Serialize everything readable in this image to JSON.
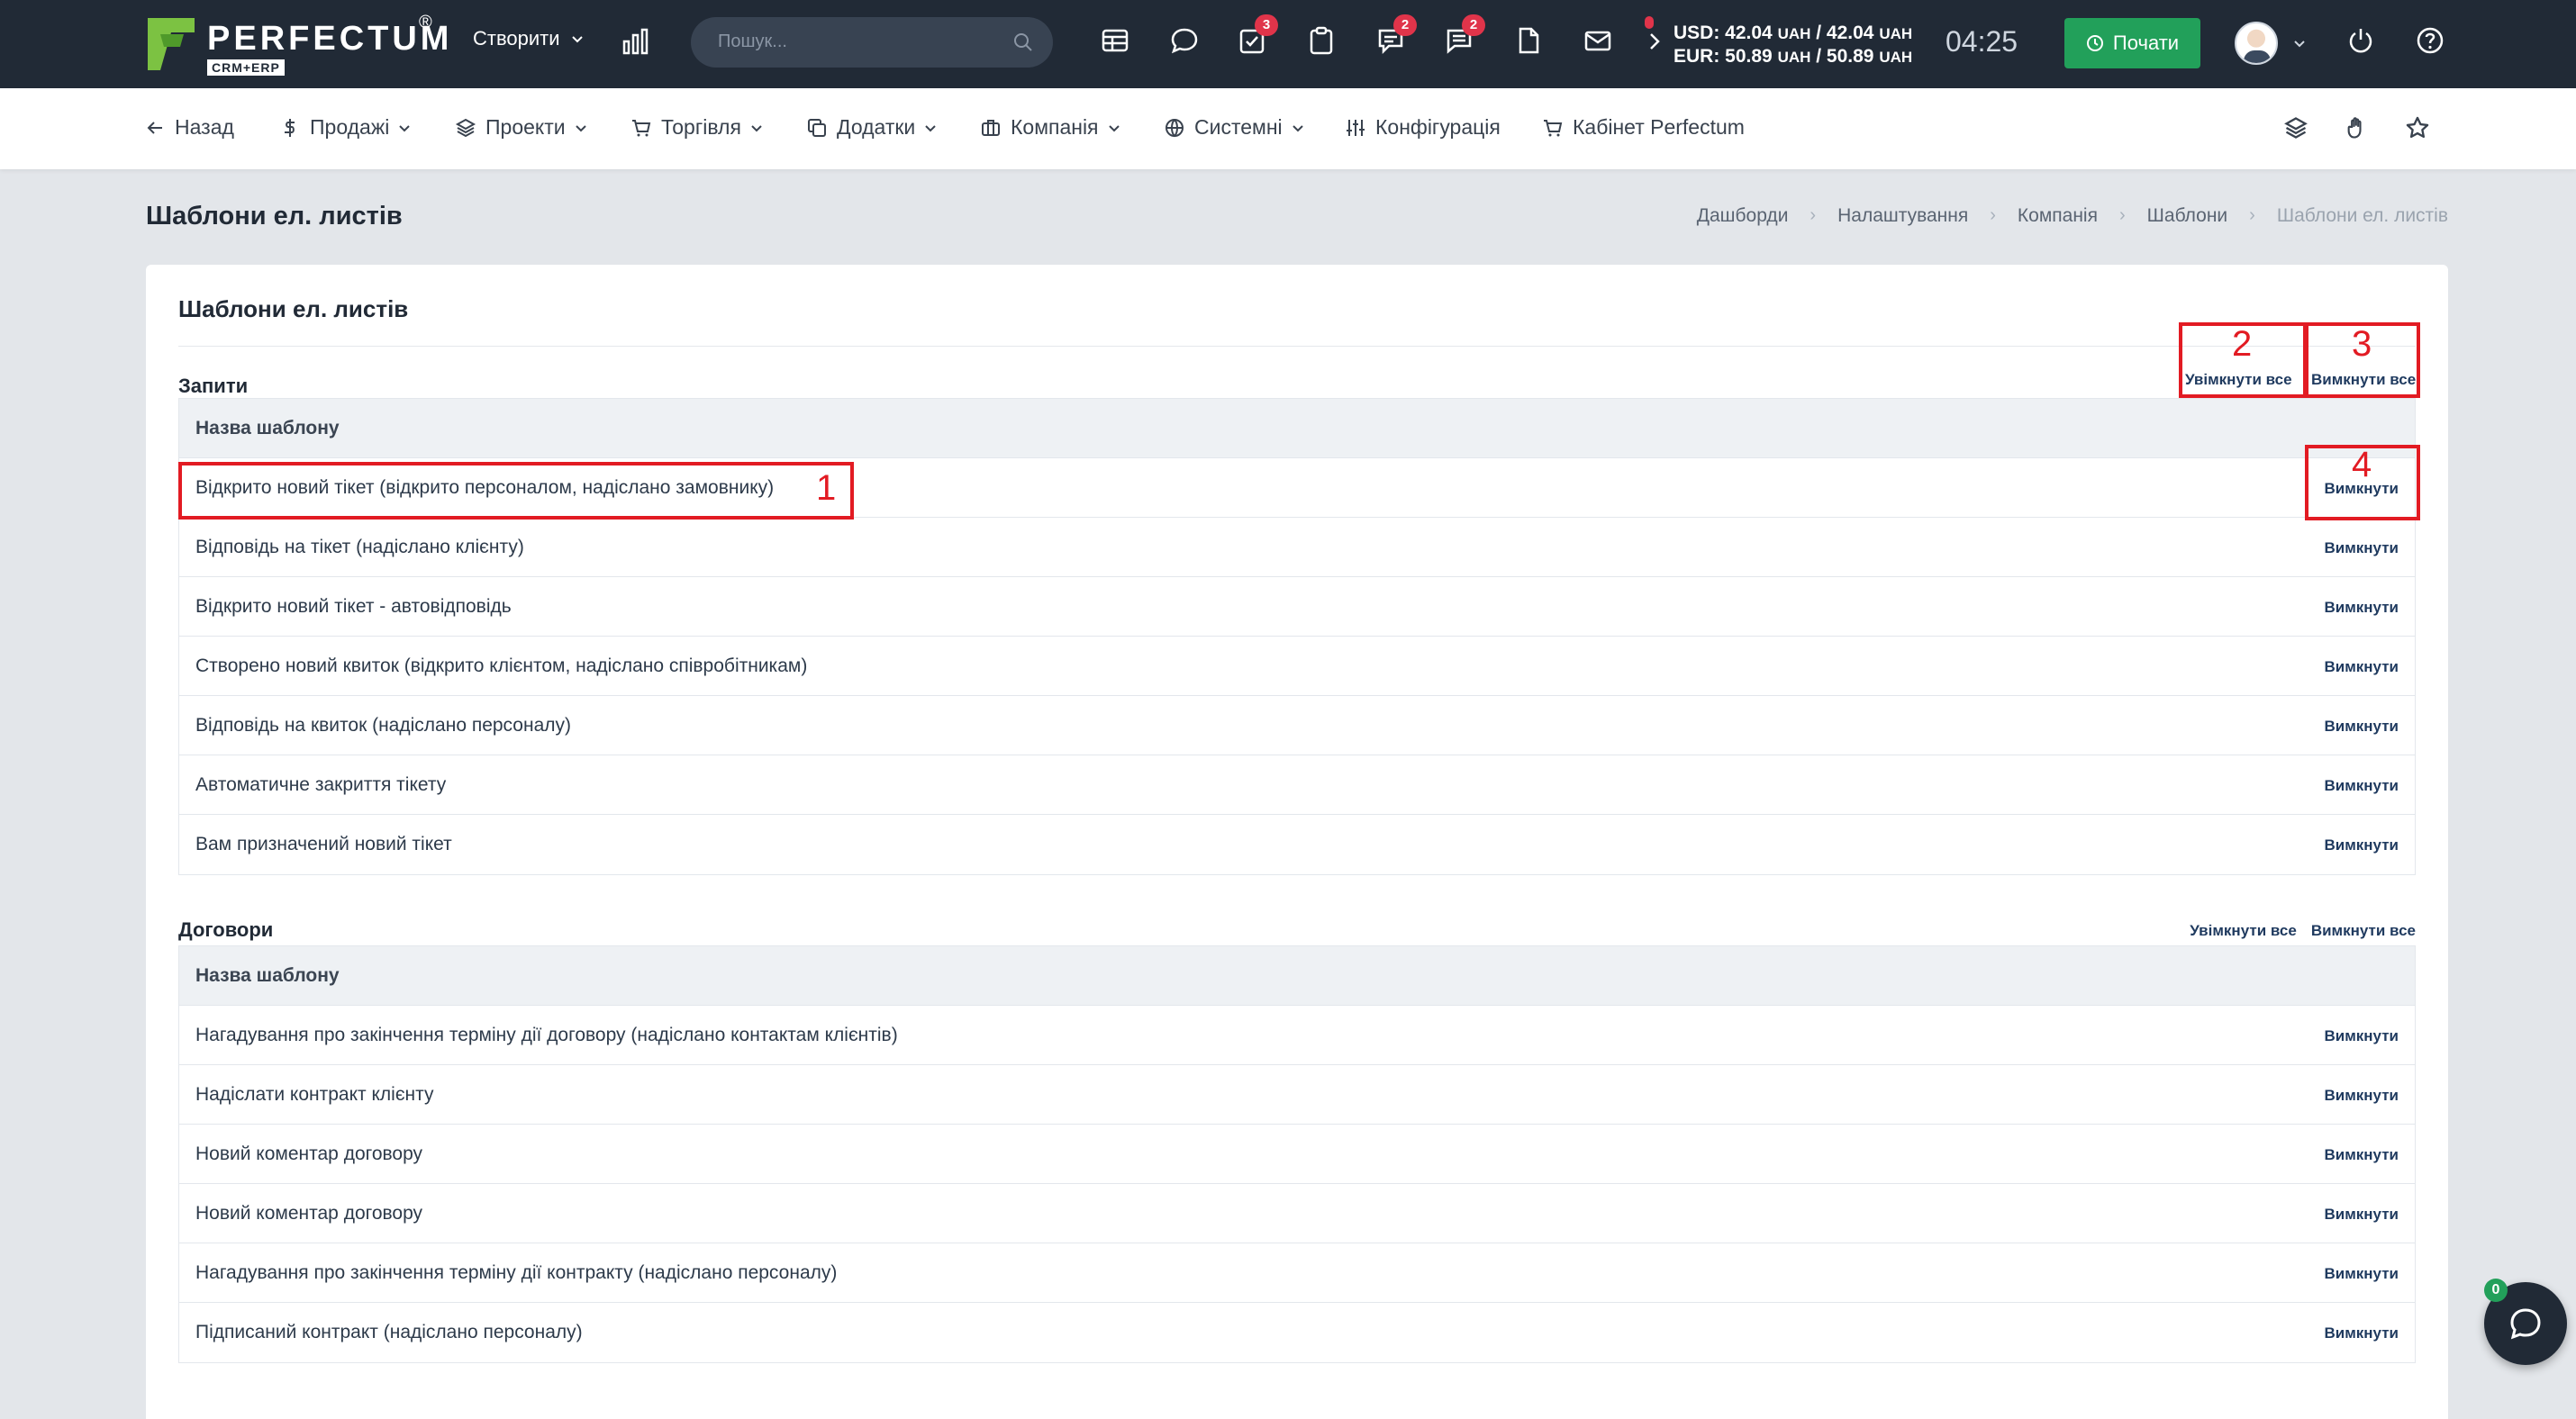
{
  "topbar": {
    "logo_text": "PERFECTUM",
    "logo_sub": "CRM+ERP",
    "logo_reg": "®",
    "create_label": "Створити",
    "search_placeholder": "Пошук...",
    "badges": {
      "tasks": "3",
      "chat": "2",
      "messages": "2"
    },
    "rates": {
      "usd": "USD: 42.04",
      "usd_unit1": "UAH",
      "usd_sep": " / 42.04",
      "usd_unit2": "UAH",
      "eur": "EUR: 50.89",
      "eur_unit1": "UAH",
      "eur_sep": " / 50.89",
      "eur_unit2": "UAH"
    },
    "clock": "04:25",
    "start_label": "Почати"
  },
  "nav": {
    "back": "Назад",
    "sales": "Продажі",
    "projects": "Проекти",
    "trade": "Торгівля",
    "addons": "Додатки",
    "company": "Компанія",
    "system": "Системні",
    "config": "Конфігурація",
    "cabinet": "Кабінет Perfectum"
  },
  "page": {
    "title": "Шаблони ел. листів",
    "breadcrumb": [
      "Дашборди",
      "Налаштування",
      "Компанія",
      "Шаблони",
      "Шаблони ел. листів"
    ]
  },
  "card": {
    "title": "Шаблони ел. листів",
    "column_header": "Назва шаблону",
    "enable_all": "Увімкнути все",
    "disable_all": "Вимкнути все",
    "disable": "Вимкнути"
  },
  "sections": {
    "requests": {
      "title": "Запити",
      "rows": [
        "Відкрито новий тікет (відкрито персоналом, надіслано замовнику)",
        "Відповідь на тікет (надіслано клієнту)",
        "Відкрито новий тікет - автовідповідь",
        "Створено новий квиток (відкрито клієнтом, надіслано співробітникам)",
        "Відповідь на квиток (надіслано персоналу)",
        "Автоматичне закриття тікету",
        "Вам призначений новий тікет"
      ]
    },
    "contracts": {
      "title": "Договори",
      "rows": [
        "Нагадування про закінчення терміну дії договору (надіслано контактам клієнтів)",
        "Надіслати контракт клієнту",
        "Новий коментар договору",
        "Новий коментар договору",
        "Нагадування про закінчення терміну дії контракту (надіслано персоналу)",
        "Підписаний контракт (надіслано персоналу)"
      ]
    }
  },
  "annotations": [
    "1",
    "2",
    "3",
    "4"
  ],
  "chat": {
    "badge": "0"
  },
  "colors": {
    "topbar": "#212a36",
    "start": "#22a05a",
    "badge": "#e0344a",
    "annotation": "#e21b23",
    "link": "#1f3a5f"
  },
  "icons": [
    "logo-icon",
    "chevron-down-icon",
    "bar-chart-icon",
    "search-icon",
    "table-icon",
    "chat-bubble-icon",
    "task-check-icon",
    "clipboard-icon",
    "comments-icon",
    "message-lines-icon",
    "document-icon",
    "mail-icon",
    "chevron-right-icon",
    "clock-icon",
    "power-icon",
    "help-icon",
    "arrow-left-icon",
    "dollar-icon",
    "layers-icon",
    "cart-icon",
    "copy-icon",
    "briefcase-icon",
    "globe-icon",
    "sliders-icon",
    "hand-icon",
    "star-icon"
  ]
}
